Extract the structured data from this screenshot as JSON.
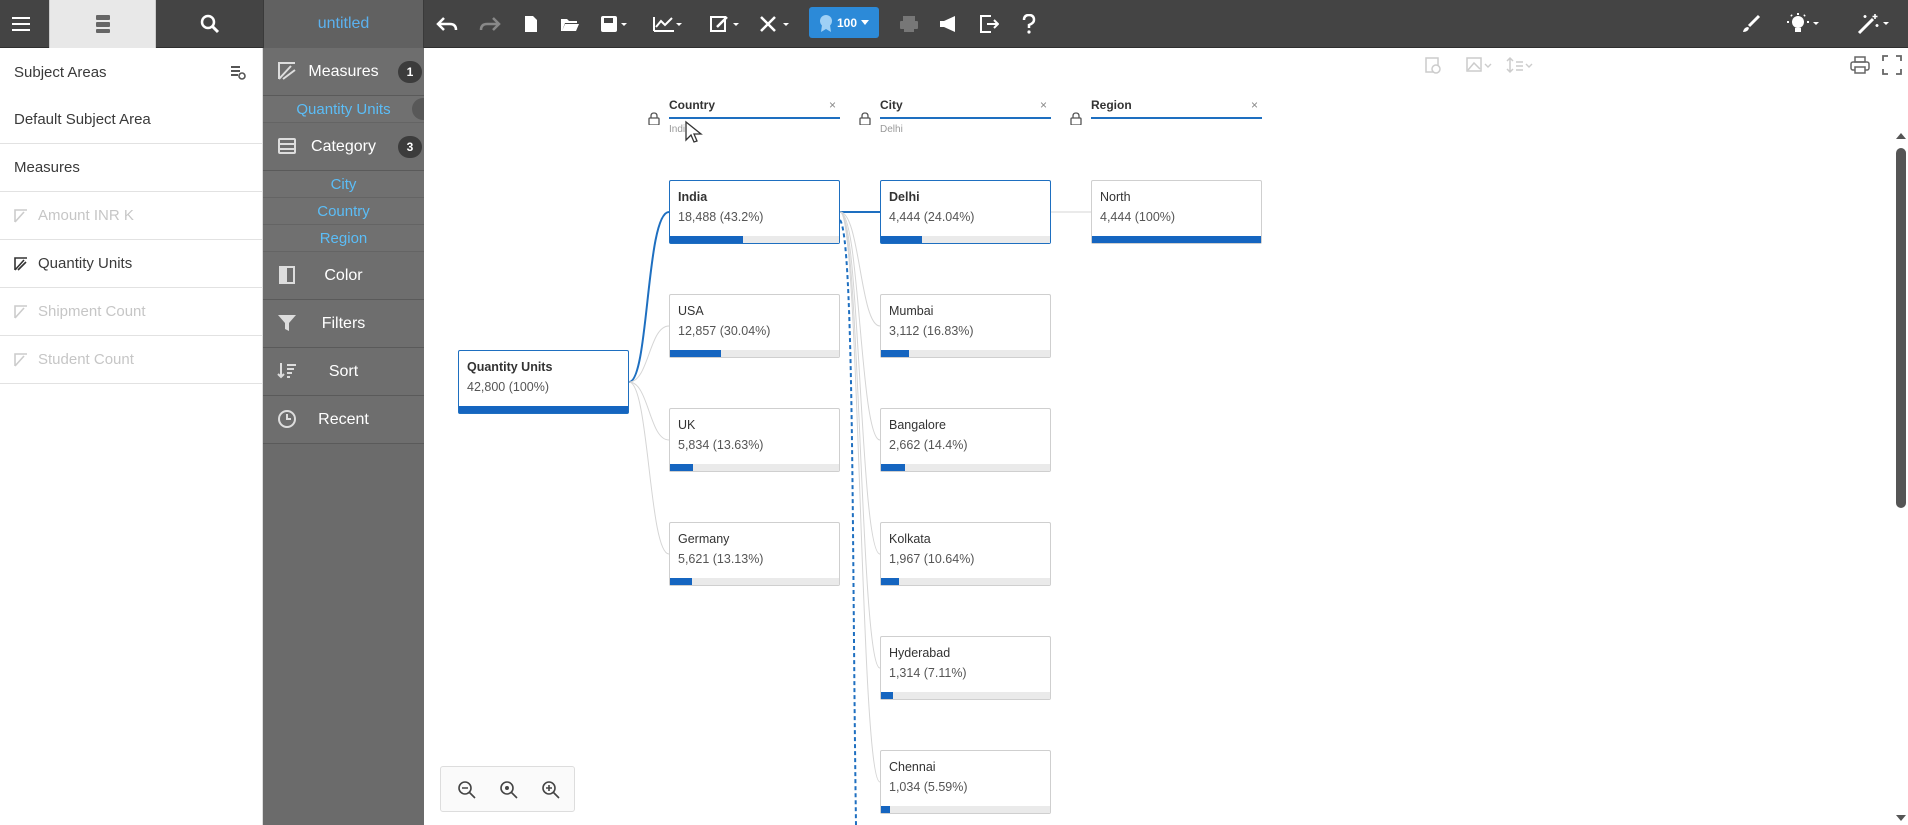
{
  "toolbar": {
    "title": "untitled",
    "score": "100"
  },
  "subject_pane": {
    "items": [
      {
        "label": "Subject Areas",
        "disabled": false
      },
      {
        "label": "Default Subject Area",
        "disabled": false
      },
      {
        "label": "Measures",
        "disabled": false
      },
      {
        "label": "Amount INR K",
        "disabled": true
      },
      {
        "label": "Quantity Units",
        "disabled": false
      },
      {
        "label": "Shipment Count",
        "disabled": true
      },
      {
        "label": "Student Count",
        "disabled": true
      }
    ]
  },
  "shelf": {
    "measures": {
      "label": "Measures",
      "count": "1",
      "items": [
        "Quantity Units"
      ]
    },
    "category": {
      "label": "Category",
      "count": "3",
      "items": [
        "City",
        "Country",
        "Region"
      ]
    },
    "color": "Color",
    "filters": "Filters",
    "sort": "Sort",
    "recent": "Recent"
  },
  "tree": {
    "levels": [
      {
        "name": "Country",
        "selected": "India",
        "close": "×"
      },
      {
        "name": "City",
        "selected": "Delhi",
        "close": "×"
      },
      {
        "name": "Region",
        "selected": "",
        "close": "×"
      }
    ],
    "root": {
      "name": "Quantity Units",
      "value": "42,800 (100%)",
      "fraction": 1.0
    },
    "countries": [
      {
        "name": "India",
        "value": "18,488 (43.2%)",
        "fraction": 0.432
      },
      {
        "name": "USA",
        "value": "12,857 (30.04%)",
        "fraction": 0.3004
      },
      {
        "name": "UK",
        "value": "5,834 (13.63%)",
        "fraction": 0.1363
      },
      {
        "name": "Germany",
        "value": "5,621 (13.13%)",
        "fraction": 0.1313
      }
    ],
    "cities": [
      {
        "name": "Delhi",
        "value": "4,444 (24.04%)",
        "fraction": 0.2404
      },
      {
        "name": "Mumbai",
        "value": "3,112 (16.83%)",
        "fraction": 0.1683
      },
      {
        "name": "Bangalore",
        "value": "2,662 (14.4%)",
        "fraction": 0.144
      },
      {
        "name": "Kolkata",
        "value": "1,967 (10.64%)",
        "fraction": 0.1064
      },
      {
        "name": "Hyderabad",
        "value": "1,314 (7.11%)",
        "fraction": 0.0711
      },
      {
        "name": "Chennai",
        "value": "1,034 (5.59%)",
        "fraction": 0.0559
      }
    ],
    "regions": [
      {
        "name": "North",
        "value": "4,444 (100%)",
        "fraction": 1.0
      }
    ]
  },
  "colors": {
    "accent": "#1565c0",
    "shelf_text": "#5bbdf7",
    "toolbar": "#444444"
  }
}
